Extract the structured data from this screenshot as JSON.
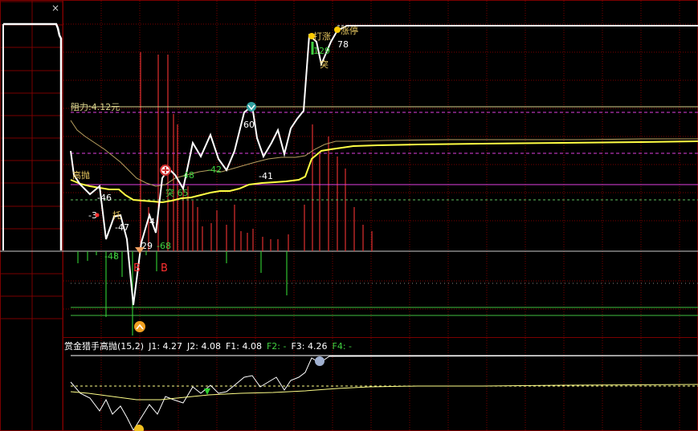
{
  "colors": {
    "bg": "#000000",
    "grid": "#7a0000",
    "price": "#ffffff",
    "avg_line": "#ffff44",
    "envelope": "#b8a060",
    "resistance": "#d6cf8a",
    "magenta": "#e040e0",
    "up_bar": "#e03030",
    "down_bar": "#30c030",
    "green_text": "#40d040",
    "sub_white": "#ffffff",
    "sub_yellow": "#ffff88"
  },
  "close_label": "×",
  "resistance_label": "阻力:4.12元",
  "chart_data": {
    "type": "line",
    "price_series": [
      0.24,
      0.24,
      0.24,
      0.24,
      0.24,
      0.24,
      0.24,
      0.27,
      0.33,
      0.42,
      0.47,
      0.47,
      0.47,
      0.48,
      0.49,
      0.5,
      0.52,
      0.5,
      0.47,
      0.48,
      0.52,
      0.54,
      0.52,
      0.5,
      0.42,
      0.38,
      0.34,
      0.32,
      0.3,
      0.3,
      0.31,
      0.34,
      0.36,
      0.38,
      0.37,
      0.36,
      0.34,
      0.3,
      0.28,
      0.25,
      0.22,
      0.21,
      0.22,
      0.23,
      0.28,
      0.32,
      0.31,
      0.29,
      0.25,
      0.16,
      0.08,
      0.08,
      0.1,
      0.14,
      0.12,
      0.09,
      0.08
    ],
    "annotations": [
      {
        "text": "高抛",
        "color": "#e8c860"
      },
      {
        "text": "-46",
        "color": "#ffffff"
      },
      {
        "text": "-3",
        "color": "#ffffff"
      },
      {
        "text": "托",
        "color": "#e8c860"
      },
      {
        "text": "-47",
        "color": "#ffffff"
      },
      {
        "text": "-48",
        "color": "#40d040"
      },
      {
        "text": "29",
        "color": "#ffffff"
      },
      {
        "text": "-68",
        "color": "#40d040"
      },
      {
        "text": "B",
        "color": "#ff3030"
      },
      {
        "text": "B",
        "color": "#ff3030"
      },
      {
        "text": "4",
        "color": "#ffffff"
      },
      {
        "text": "突 65",
        "color": "#40d040"
      },
      {
        "text": "48",
        "color": "#40d040"
      },
      {
        "text": "-42",
        "color": "#40d040"
      },
      {
        "text": "60",
        "color": "#ffffff"
      },
      {
        "text": "-41",
        "color": "#ffffff"
      },
      {
        "text": "打涨",
        "color": "#e8c860"
      },
      {
        "text": "129",
        "color": "#40d040"
      },
      {
        "text": "突",
        "color": "#e8c860"
      },
      {
        "text": "涨停",
        "color": "#e8c860"
      },
      {
        "text": "78",
        "color": "#ffffff"
      }
    ]
  },
  "sub_panel": {
    "title": "赏金猎手高抛(15,2)",
    "j1": "J1: 4.27",
    "j2": "J2: 4.08",
    "f1": "F1: 4.08",
    "f2": "F2: -",
    "f3": "F3: 4.26",
    "f4": "F4: -"
  }
}
